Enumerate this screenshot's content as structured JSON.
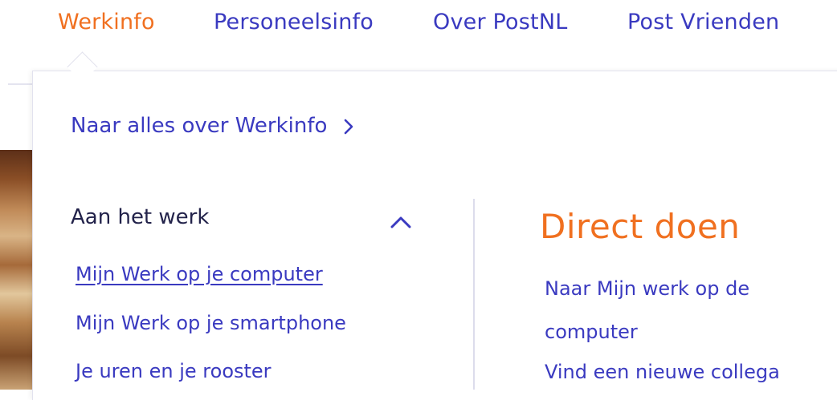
{
  "nav": {
    "items": [
      {
        "label": "Werkinfo",
        "active": true
      },
      {
        "label": "Personeelsinfo",
        "active": false
      },
      {
        "label": "Over PostNL",
        "active": false
      },
      {
        "label": "Post Vrienden",
        "active": false
      }
    ]
  },
  "dropdown": {
    "overview_link": "Naar alles over Werkinfo",
    "overview_icon": "chevron-right-icon",
    "section": {
      "title": "Aan het werk",
      "toggle_icon": "chevron-up-icon",
      "links": [
        {
          "label": "Mijn Werk op je computer",
          "active": true
        },
        {
          "label": "Mijn Werk op je smartphone",
          "active": false
        },
        {
          "label": "Je uren en je rooster",
          "active": false
        }
      ]
    },
    "direct": {
      "title": "Direct doen",
      "links": [
        "Naar Mijn werk op de computer",
        "Vind een nieuwe collega"
      ]
    }
  },
  "colors": {
    "accent_orange": "#f07020",
    "link_blue": "#3a3ac0",
    "text_dark": "#22224a"
  }
}
